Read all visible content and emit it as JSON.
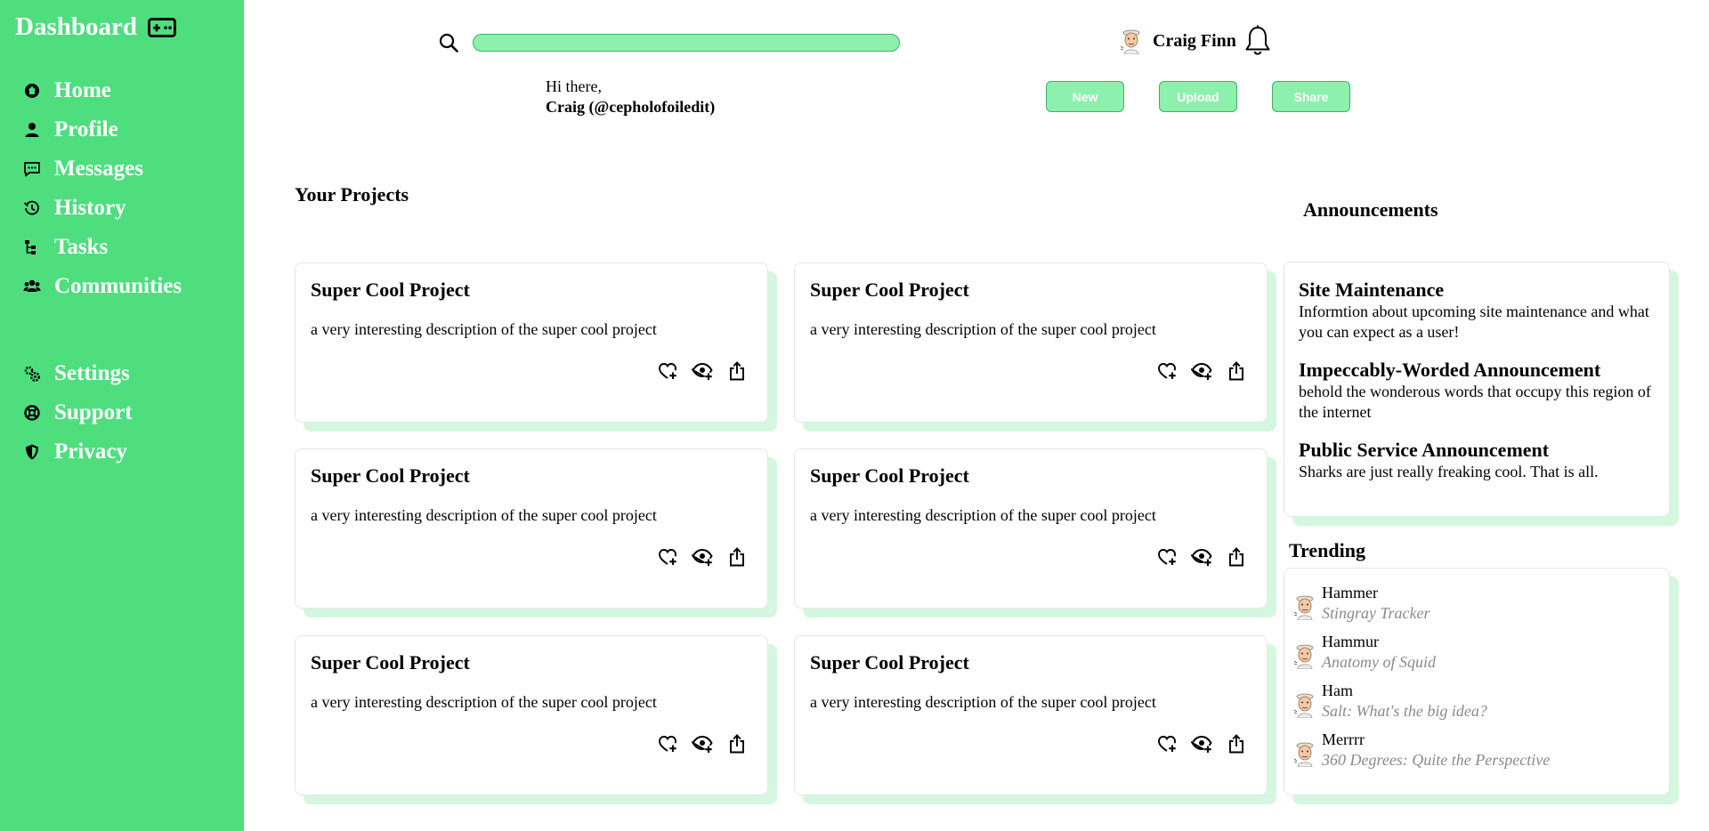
{
  "sidebar": {
    "brand": "Dashboard",
    "brand_icon": "gamepad-icon",
    "nav_primary": [
      {
        "label": "Home",
        "icon": "home-icon"
      },
      {
        "label": "Profile",
        "icon": "person-icon"
      },
      {
        "label": "Messages",
        "icon": "chat-icon"
      },
      {
        "label": "History",
        "icon": "history-icon"
      },
      {
        "label": "Tasks",
        "icon": "tasks-icon"
      },
      {
        "label": "Communities",
        "icon": "communities-icon"
      }
    ],
    "nav_secondary": [
      {
        "label": "Settings",
        "icon": "gears-icon"
      },
      {
        "label": "Support",
        "icon": "lifebuoy-icon"
      },
      {
        "label": "Privacy",
        "icon": "shield-icon"
      }
    ]
  },
  "header": {
    "search_placeholder": "",
    "user_name": "Craig Finn",
    "greeting_line1": "Hi there,",
    "greeting_line2": "Craig (@cepholofoiledit)",
    "buttons": {
      "new": "New",
      "upload": "Upload",
      "share": "Share"
    }
  },
  "projects": {
    "heading": "Your Projects",
    "items": [
      {
        "title": "Super Cool Project",
        "description": "a very interesting description of the super cool project"
      },
      {
        "title": "Super Cool Project",
        "description": "a very interesting description of the super cool project"
      },
      {
        "title": "Super Cool Project",
        "description": "a very interesting description of the super cool project"
      },
      {
        "title": "Super Cool Project",
        "description": "a very interesting description of the super cool project"
      },
      {
        "title": "Super Cool Project",
        "description": "a very interesting description of the super cool project"
      },
      {
        "title": "Super Cool Project",
        "description": "a very interesting description of the super cool project"
      }
    ]
  },
  "announcements": {
    "heading": "Announcements",
    "items": [
      {
        "title": "Site Maintenance",
        "body": "Informtion about upcoming site maintenance and what you can expect as a user!"
      },
      {
        "title": "Impeccably-Worded Announcement",
        "body": "behold the wonderous words that occupy this region of the internet"
      },
      {
        "title": "Public Service Announcement",
        "body": "Sharks are just really freaking cool. That is all."
      }
    ]
  },
  "trending": {
    "heading": "Trending",
    "items": [
      {
        "user": "Hammer",
        "project": "Stingray Tracker"
      },
      {
        "user": "Hammur",
        "project": "Anatomy of Squid"
      },
      {
        "user": "Ham",
        "project": "Salt: What's the big idea?"
      },
      {
        "user": "Merrrr",
        "project": "360 Degrees: Quite the Perspective"
      }
    ]
  },
  "colors": {
    "sidebar": "#4ede7e",
    "accent_light": "#8ef0ad",
    "card_shadow": "#d4f7df"
  }
}
